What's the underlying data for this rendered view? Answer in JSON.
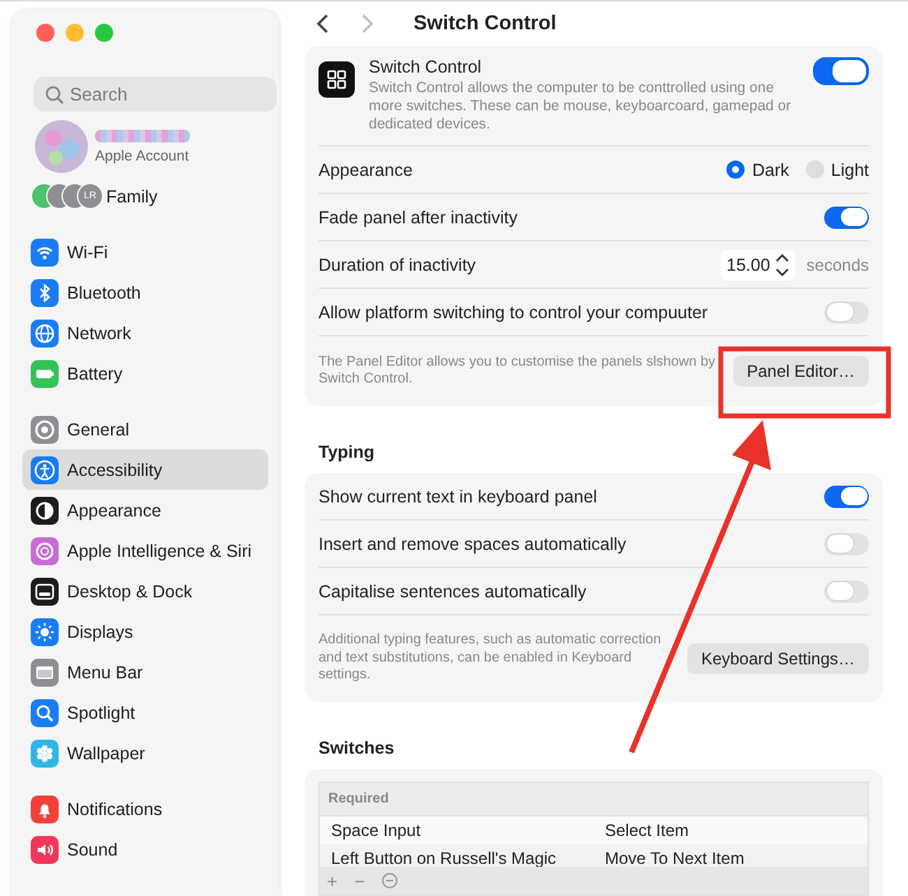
{
  "sidebar": {
    "search": {
      "placeholder": "Search"
    },
    "account": {
      "label": "Apple Account"
    },
    "family": {
      "label": "Family",
      "initials": "LR"
    },
    "groups": [
      [
        {
          "label": "Wi-Fi",
          "color": "#1a7cf5",
          "selected": false
        },
        {
          "label": "Bluetooth",
          "color": "#1a7cf5",
          "selected": false
        },
        {
          "label": "Network",
          "color": "#1a7cf5",
          "selected": false
        },
        {
          "label": "Battery",
          "color": "#34c359",
          "selected": false
        }
      ],
      [
        {
          "label": "General",
          "color": "#8e8e93",
          "selected": false
        },
        {
          "label": "Accessibility",
          "color": "#1a7cf5",
          "selected": true
        },
        {
          "label": "Appearance",
          "color": "#1c1c1e",
          "selected": false
        },
        {
          "label": "Apple Intelligence & Siri",
          "color": "#c86bd8",
          "selected": false
        },
        {
          "label": "Desktop & Dock",
          "color": "#1c1c1e",
          "selected": false
        },
        {
          "label": "Displays",
          "color": "#1a7cf5",
          "selected": false
        },
        {
          "label": "Menu Bar",
          "color": "#8e8e93",
          "selected": false
        },
        {
          "label": "Spotlight",
          "color": "#1a7cf5",
          "selected": false
        },
        {
          "label": "Wallpaper",
          "color": "#2fb8e6",
          "selected": false
        }
      ],
      [
        {
          "label": "Notifications",
          "color": "#f2413b",
          "selected": false
        },
        {
          "label": "Sound",
          "color": "#f0365a",
          "selected": false
        }
      ]
    ]
  },
  "header": {
    "title": "Switch Control",
    "back_disabled": false,
    "forward_disabled": true
  },
  "switch_card": {
    "title": "Switch Control",
    "description": "Switch Control allows the computer to be conttrolled using one more switches. These can be mouse, keyboarcoard, gamepad or dedicated devices.",
    "on": true,
    "rows": [
      {
        "kind": "radio",
        "label": "Appearance",
        "options": [
          {
            "label": "Dark",
            "selected": true
          },
          {
            "label": "Light",
            "selected": false
          }
        ]
      },
      {
        "kind": "toggle",
        "label": "Fade panel after inactivity",
        "on": true
      },
      {
        "kind": "stepper",
        "label": "Duration of inactivity",
        "value": "15.00",
        "unit": "seconds"
      },
      {
        "kind": "toggle",
        "label": "Allow platform switching to control your compuuter",
        "on": false
      }
    ],
    "footer": {
      "text": "The Panel Editor allows you to customise the panels slshown by Switch Control.",
      "button": "Panel Editor…"
    }
  },
  "typing": {
    "title": "Typing",
    "rows": [
      {
        "kind": "toggle",
        "label": "Show current text in keyboard panel",
        "on": true
      },
      {
        "kind": "toggle",
        "label": "Insert and remove spaces automatically",
        "on": false
      },
      {
        "kind": "toggle",
        "label": "Capitalise sentences automatically",
        "on": false
      }
    ],
    "footer": {
      "text": "Additional typing features, such as automatic correction and text substitutions, can be enabled in Keyboard settings.",
      "button": "Keyboard Settings…"
    }
  },
  "switches": {
    "title": "Switches",
    "table": {
      "group": "Required",
      "rows": [
        [
          "Space Input",
          "Select Item"
        ],
        [
          "Left Button on Russell's Magic",
          "Move To Next Item"
        ]
      ]
    },
    "toolbar": [
      "+",
      "−"
    ]
  },
  "annotation_box": {
    "color": "#e8322a"
  },
  "annotation_arrow": {
    "color": "#e8322a"
  }
}
